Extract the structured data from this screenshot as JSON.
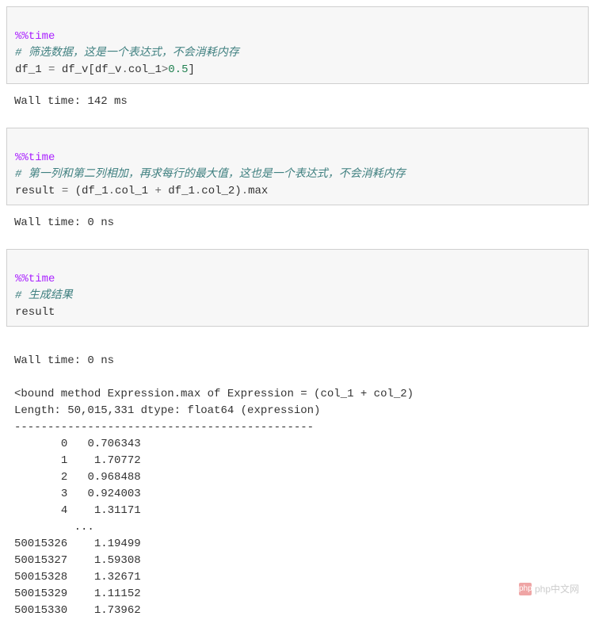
{
  "cells": [
    {
      "magic": "%%time",
      "comment": "# 筛选数据，这是一个表达式，不会消耗内存",
      "code_parts": {
        "lhs": "df_1 ",
        "eq": "=",
        "rhs1": " df_v[df_v",
        "dot": ".",
        "attr": "col_1",
        "gt": ">",
        "num": "0.5",
        "rhs2": "]"
      },
      "output": "Wall time: 142 ms"
    },
    {
      "magic": "%%time",
      "comment": "# 第一列和第二列相加，再求每行的最大值，这也是一个表达式，不会消耗内存",
      "code_parts": {
        "lhs": "result ",
        "eq": "=",
        "p1": " (df_1",
        "dot": ".",
        "a1": "col_1 ",
        "plus": "+",
        "p2": " df_1",
        "a2": "col_2)",
        "method": "max"
      },
      "output": "Wall time: 0 ns"
    },
    {
      "magic": "%%time",
      "comment": "# 生成结果",
      "code": "result",
      "output": "Wall time: 0 ns"
    }
  ],
  "result_header": "<bound method Expression.max of Expression = (col_1 + col_2)",
  "result_length": "Length: 50,015,331 dtype: float64 (expression)",
  "result_divider": "---------------------------------------------",
  "head_rows": [
    {
      "idx": "0",
      "val": "0.706343"
    },
    {
      "idx": "1",
      "val": "1.70772"
    },
    {
      "idx": "2",
      "val": "0.968488"
    },
    {
      "idx": "3",
      "val": "0.924003"
    },
    {
      "idx": "4",
      "val": "1.31171"
    }
  ],
  "ellipsis": "...",
  "tail_rows": [
    {
      "idx": "50015326",
      "val": "1.19499"
    },
    {
      "idx": "50015327",
      "val": "1.59308"
    },
    {
      "idx": "50015328",
      "val": "1.32671"
    },
    {
      "idx": "50015329",
      "val": "1.11152"
    },
    {
      "idx": "50015330",
      "val": "1.73962"
    }
  ],
  "watermark": {
    "logo": "php",
    "text": "php中文网"
  }
}
